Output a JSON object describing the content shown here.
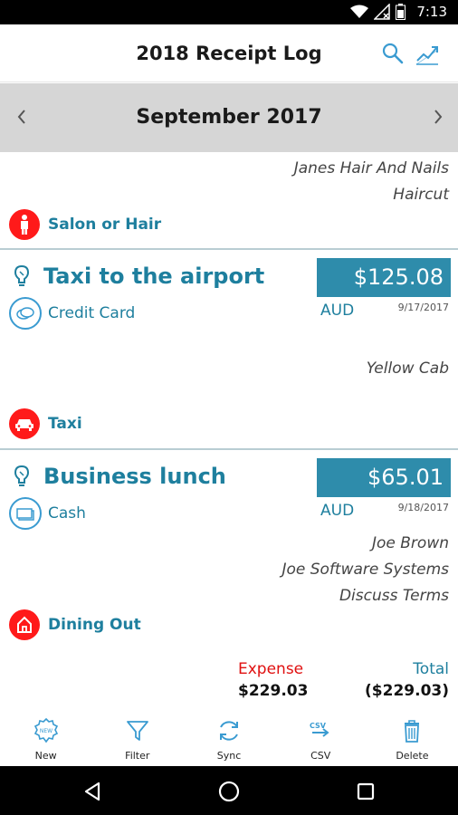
{
  "status_bar": {
    "time": "7:13"
  },
  "app_bar": {
    "title": "2018 Receipt Log"
  },
  "month_nav": {
    "month": "September 2017"
  },
  "previous_entry": {
    "lines": [
      "Janes Hair And Nails",
      "Haircut"
    ],
    "category": "Salon or Hair"
  },
  "entries": [
    {
      "title": "Taxi to the airport",
      "amount": "$125.08",
      "currency": "AUD",
      "date": "9/17/2017",
      "payment": "Credit Card",
      "lines": [
        "Yellow Cab"
      ],
      "category": "Taxi"
    },
    {
      "title": "Business lunch",
      "amount": "$65.01",
      "currency": "AUD",
      "date": "9/18/2017",
      "payment": "Cash",
      "lines": [
        "Joe Brown",
        "Joe Software Systems",
        "Discuss Terms"
      ],
      "category": "Dining Out"
    }
  ],
  "totals": {
    "expense_label": "Expense",
    "expense_value": "$229.03",
    "total_label": "Total",
    "total_value": "($229.03)"
  },
  "toolbar": {
    "new_label": "New",
    "new_badge": "NEW",
    "filter_label": "Filter",
    "sync_label": "Sync",
    "csv_label": "CSV",
    "csv_badge": "CSV",
    "delete_label": "Delete"
  },
  "colors": {
    "accent": "#1e7f9e",
    "amount_bg": "#2e8cab",
    "category_icon": "#ff1a1a",
    "expense": "#e01010",
    "month_bar": "#d6d6d6"
  }
}
